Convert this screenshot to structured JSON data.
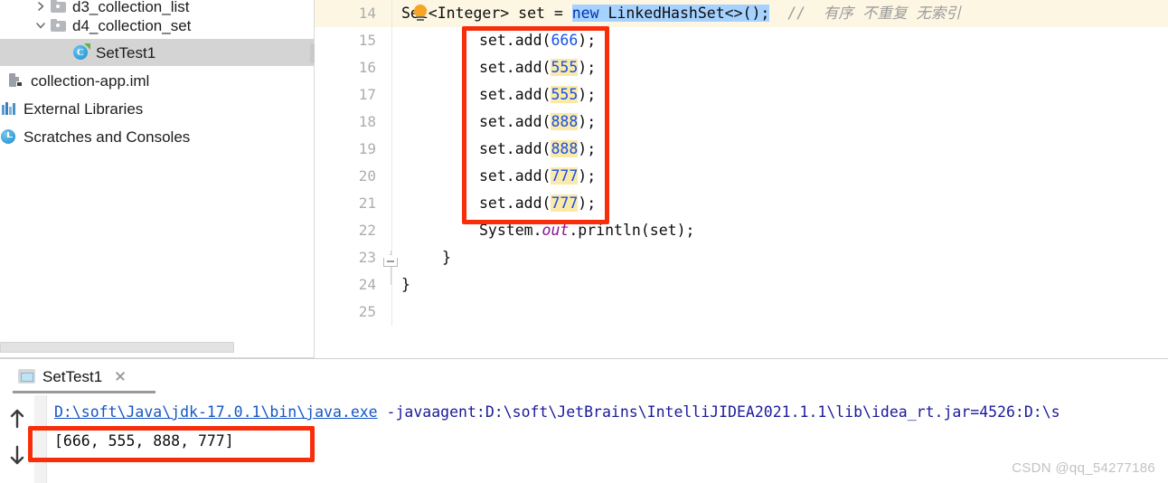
{
  "sidebar": {
    "items": [
      {
        "label": "d3_collection_list",
        "icon": "folder-icon",
        "arrow": "chevron-right-icon",
        "indent": 36,
        "selected": false,
        "partial": true
      },
      {
        "label": "d4_collection_set",
        "icon": "folder-icon",
        "arrow": "chevron-down-icon",
        "indent": 36,
        "selected": false,
        "partial": false
      },
      {
        "label": "SetTest1",
        "icon": "java-class-icon",
        "arrow": "none",
        "indent": 80,
        "selected": true,
        "partial": false
      },
      {
        "label": "collection-app.iml",
        "icon": "module-file-icon",
        "arrow": "none",
        "indent": 8,
        "selected": false,
        "partial": false
      },
      {
        "label": "External Libraries",
        "icon": "external-libraries-icon",
        "arrow": "none",
        "indent": 0,
        "selected": false,
        "partial": false
      },
      {
        "label": "Scratches and Consoles",
        "icon": "scratches-clock-icon",
        "arrow": "none",
        "indent": 0,
        "selected": false,
        "partial": false
      }
    ]
  },
  "editor": {
    "lines": [
      {
        "no": "14",
        "current": true
      },
      {
        "no": "15",
        "current": false
      },
      {
        "no": "16",
        "current": false
      },
      {
        "no": "17",
        "current": false
      },
      {
        "no": "18",
        "current": false
      },
      {
        "no": "19",
        "current": false
      },
      {
        "no": "20",
        "current": false
      },
      {
        "no": "21",
        "current": false
      },
      {
        "no": "22",
        "current": false
      },
      {
        "no": "23",
        "current": false
      },
      {
        "no": "24",
        "current": false
      },
      {
        "no": "25",
        "current": false
      }
    ],
    "code": {
      "l14_decl": "Set<Integer> set = ",
      "l14_kw_new": "new",
      "l14_ctor": " LinkedHashSet<>();",
      "l14_comment": "//  有序 不重复 无索引",
      "l15_call": "set.add(",
      "l15_num": "666",
      "l15_end": ");",
      "l16_call": "set.add(",
      "l16_num": "555",
      "l16_end": ");",
      "l17_call": "set.add(",
      "l17_num": "555",
      "l17_end": ");",
      "l18_call": "set.add(",
      "l18_num": "888",
      "l18_end": ");",
      "l19_call": "set.add(",
      "l19_num": "888",
      "l19_end": ");",
      "l20_call": "set.add(",
      "l20_num": "777",
      "l20_end": ");",
      "l21_call": "set.add(",
      "l21_num": "777",
      "l21_end": ");",
      "l22_a": "System.",
      "l22_field": "out",
      "l22_b": ".println(set);",
      "l23_brace": "}",
      "l24_brace": "}"
    },
    "icons": {
      "intention_bulb": "lightbulb-icon",
      "fold_marker": "code-fold-marker-icon"
    }
  },
  "run_window": {
    "tab_label": "SetTest1",
    "tab_icon": "run-configuration-icon",
    "close_icon": "close-icon",
    "nav_up_icon": "arrow-up-icon",
    "nav_down_icon": "arrow-down-icon",
    "console": {
      "command_path": "D:\\soft\\Java\\jdk-17.0.1\\bin\\java.exe",
      "command_args": " -javaagent:D:\\soft\\JetBrains\\IntelliJIDEA2021.1.1\\lib\\idea_rt.jar=4526:D:\\s",
      "output": "[666, 555, 888, 777]"
    }
  },
  "watermark": "CSDN @qq_54277186",
  "colors": {
    "accent_selection": "#a6d2ff",
    "keyword": "#0033b3",
    "number": "#1750eb",
    "comment": "#9b9b9b",
    "duplicate_highlight": "#fbe9a7",
    "annotation_red": "#f92d0a",
    "current_line": "#fdf6e3",
    "tree_selected": "#d4d4d4"
  }
}
